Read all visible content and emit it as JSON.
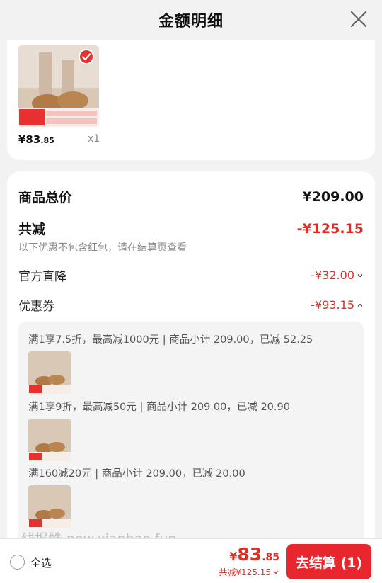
{
  "header": {
    "title": "金额明细"
  },
  "item": {
    "price_int": "¥83",
    "price_dec": ".85",
    "qty": "x1"
  },
  "summary": {
    "total_label": "商品总价",
    "total_value": "¥209.00",
    "reduce_label": "共减",
    "reduce_value": "-¥125.15",
    "note": "以下优惠不包含红包，请在结算页查看",
    "official_label": "官方直降",
    "official_value": "-¥32.00",
    "coupon_label": "优惠券",
    "coupon_value": "-¥93.15"
  },
  "coupons": [
    {
      "text": "满1享7.5折，最高减1000元 | 商品小计 209.00，已减 52.25"
    },
    {
      "text": "满1享9折，最高减50元 | 商品小计 209.00，已减 20.90"
    },
    {
      "text": "满160减20元 | 商品小计 209.00，已减 20.00"
    }
  ],
  "watermark": "线报酷-new.xianbao.fun",
  "bottom": {
    "select_all": "全选",
    "yen": "¥",
    "price_int": "83",
    "price_dec": ".85",
    "saved": "共减¥125.15",
    "checkout": "去结算 (1)"
  },
  "colors": {
    "accent": "#e8262d",
    "red_text": "#e02e24"
  },
  "icons": [
    "close-icon",
    "check-icon",
    "chevron-down-icon",
    "chevron-up-icon",
    "radio-icon"
  ]
}
